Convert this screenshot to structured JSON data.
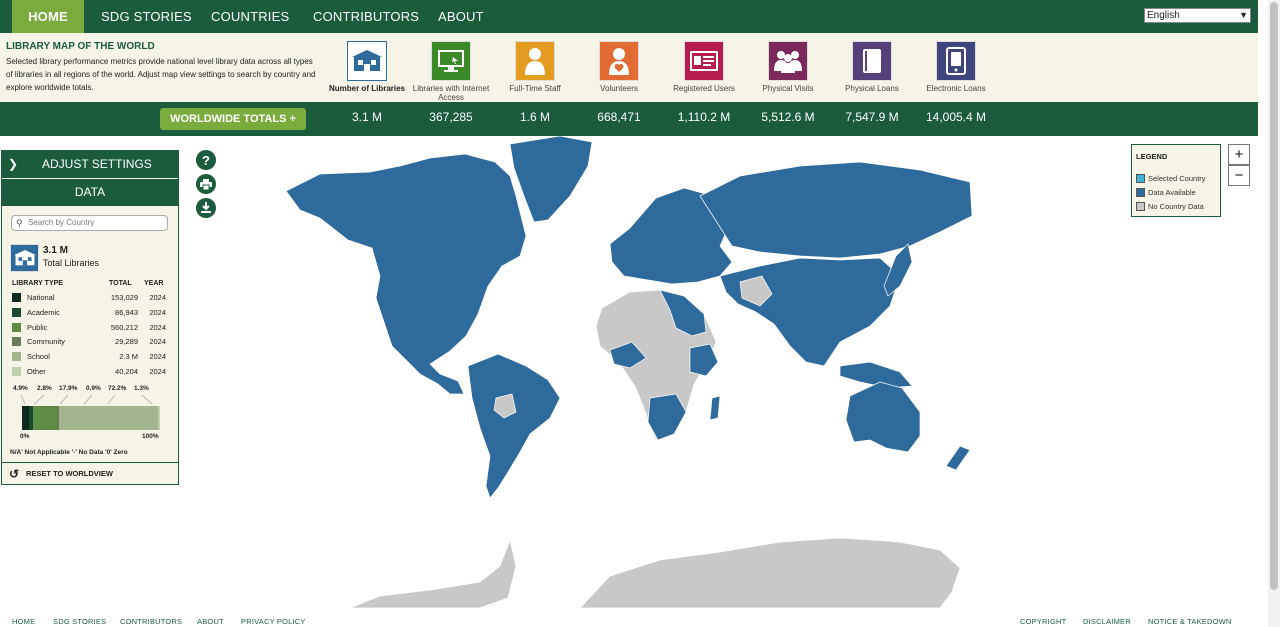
{
  "nav": {
    "items": [
      "HOME",
      "SDG STORIES",
      "COUNTRIES",
      "CONTRIBUTORS",
      "ABOUT"
    ],
    "active": "HOME",
    "language": "English"
  },
  "header": {
    "title": "LIBRARY MAP OF THE WORLD",
    "description": "Selected library performance metrics provide national level library data across all types of libraries in all regions of the world. Adjust map view settings to search by country and explore worldwide totals."
  },
  "metrics": [
    {
      "label": "Number of Libraries",
      "total": "3.1 M",
      "icon": "library-building-icon",
      "color": "#2e6a9c",
      "selected": true
    },
    {
      "label": "Libraries with Internet Access",
      "total": "367,285",
      "icon": "computer-monitor-icon",
      "color": "#3b8a28"
    },
    {
      "label": "Full-Time Staff",
      "total": "1.6 M",
      "icon": "staff-person-icon",
      "color": "#e39c20"
    },
    {
      "label": "Volunteers",
      "total": "668,471",
      "icon": "volunteer-heart-icon",
      "color": "#e26b34"
    },
    {
      "label": "Registered Users",
      "total": "1,110.2 M",
      "icon": "id-card-icon",
      "color": "#b51d4d"
    },
    {
      "label": "Physical Visits",
      "total": "5,512.6 M",
      "icon": "people-group-icon",
      "color": "#7c2a5c"
    },
    {
      "label": "Physical Loans",
      "total": "7,547.9 M",
      "icon": "book-icon",
      "color": "#55407a"
    },
    {
      "label": "Electronic Loans",
      "total": "14,005.4 M",
      "icon": "tablet-icon",
      "color": "#40467d"
    }
  ],
  "worldwide_button": "WORLDWIDE TOTALS +",
  "panel": {
    "adjust_label": "ADJUST SETTINGS",
    "data_label": "DATA",
    "search_placeholder": "Search by Country",
    "total_value": "3.1 M",
    "total_label": "Total Libraries",
    "columns": [
      "LIBRARY TYPE",
      "TOTAL",
      "YEAR"
    ],
    "types": [
      {
        "name": "National",
        "total": "153,029",
        "year": "2024",
        "color": "#0f2a1c"
      },
      {
        "name": "Academic",
        "total": "86,943",
        "year": "2024",
        "color": "#174a2e"
      },
      {
        "name": "Public",
        "total": "560,212",
        "year": "2024",
        "color": "#5f8c43"
      },
      {
        "name": "Community",
        "total": "29,289",
        "year": "2024",
        "color": "#6c7a57"
      },
      {
        "name": "School",
        "total": "2.3 M",
        "year": "2024",
        "color": "#a3b48e"
      },
      {
        "name": "Other",
        "total": "40,204",
        "year": "2024",
        "color": "#c3cdb0"
      }
    ],
    "percents": [
      "4.9%",
      "2.8%",
      "17.9%",
      "0.9%",
      "72.2%",
      "1.3%"
    ],
    "share_values": [
      4.9,
      2.8,
      17.9,
      0.9,
      72.2,
      1.3
    ],
    "scale_min": "0%",
    "scale_max": "100%",
    "note": "N/A' Not Applicable '-' No Data '0' Zero",
    "reset_label": "RESET TO WORLDVIEW"
  },
  "legend": {
    "title": "LEGEND",
    "items": [
      {
        "label": "Selected Country",
        "color": "#3fb2d9"
      },
      {
        "label": "Data Available",
        "color": "#2e6a9c"
      },
      {
        "label": "No Country Data",
        "color": "#c8c8c8"
      }
    ]
  },
  "zoom": {
    "in": "+",
    "out": "−"
  },
  "footer": {
    "left": [
      "HOME",
      "SDG STORIES",
      "CONTRIBUTORS",
      "ABOUT",
      "PRIVACY POLICY"
    ],
    "right": [
      "COPYRIGHT",
      "DISCLAIMER",
      "NOTICE & TAKEDOWN"
    ]
  }
}
